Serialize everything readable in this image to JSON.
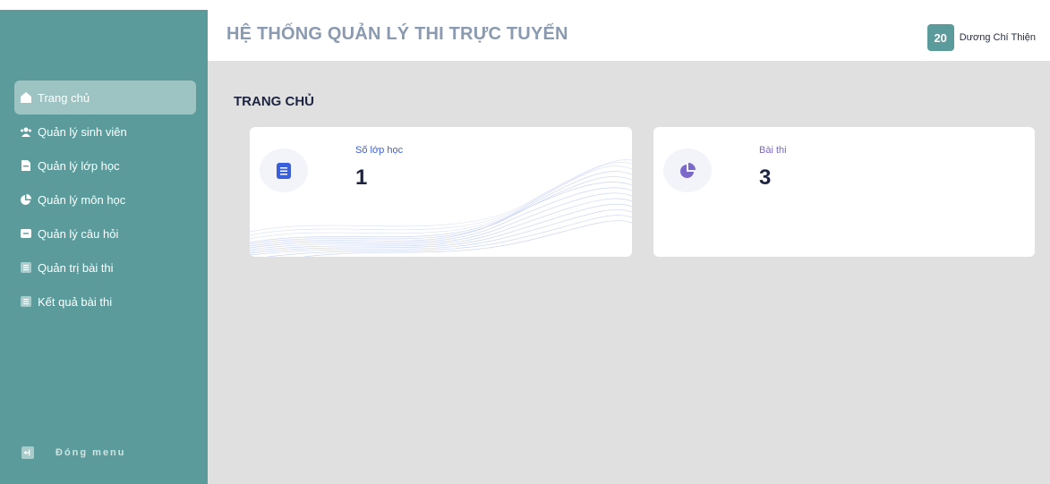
{
  "header": {
    "title": "HỆ THỐNG QUẢN LÝ THI TRỰC TUYẾN",
    "user_badge": "20",
    "user_name": "Dương Chí Thiện"
  },
  "sidebar": {
    "items": [
      {
        "label": "Trang chủ",
        "icon": "home-icon",
        "active": true
      },
      {
        "label": "Quản lý sinh viên",
        "icon": "users-icon",
        "active": false
      },
      {
        "label": "Quản lý lớp học",
        "icon": "file-icon",
        "active": false
      },
      {
        "label": "Quản lý môn học",
        "icon": "pie-icon",
        "active": false
      },
      {
        "label": "Quản lý câu hỏi",
        "icon": "folder-icon",
        "active": false
      },
      {
        "label": "Quản trị bài thi",
        "icon": "list-icon",
        "active": false
      },
      {
        "label": "Kết quả bài thi",
        "icon": "list-icon",
        "active": false
      }
    ],
    "close_label": "Đóng menu"
  },
  "main": {
    "page_title": "TRANG CHỦ",
    "cards": [
      {
        "label": "Số lớp học",
        "value": "1",
        "icon": "document-icon"
      },
      {
        "label": "Bài thi",
        "value": "3",
        "icon": "pie-chart-icon"
      }
    ]
  },
  "colors": {
    "sidebar": "#5b9b9b",
    "active_item": "#9ec3c3",
    "card1_accent": "#3b5fd9",
    "card2_accent": "#7b68c8"
  }
}
